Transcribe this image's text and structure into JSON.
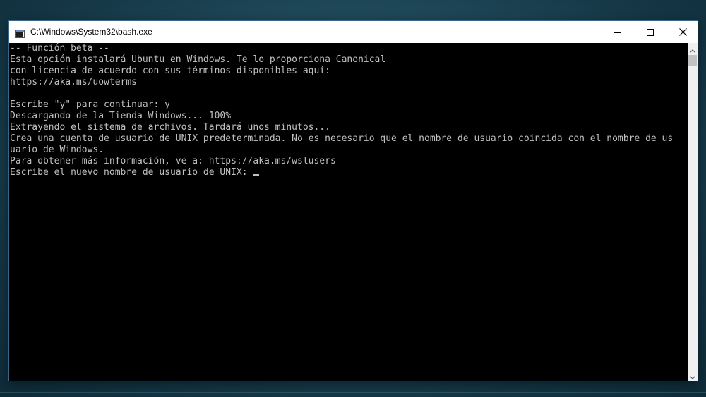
{
  "window": {
    "title": "C:\\Windows\\System32\\bash.exe",
    "icon": "console-window-icon",
    "controls": {
      "minimize_icon": "minimize-icon",
      "maximize_icon": "maximize-icon",
      "close_icon": "close-icon"
    }
  },
  "terminal": {
    "lines": [
      "-- Función beta --",
      "Esta opción instalará Ubuntu en Windows. Te lo proporciona Canonical",
      "con licencia de acuerdo con sus términos disponibles aquí:",
      "https://aka.ms/uowterms",
      "",
      "Escribe \"y\" para continuar: y",
      "Descargando de la Tienda Windows... 100%",
      "Extrayendo el sistema de archivos. Tardará unos minutos...",
      "Crea una cuenta de usuario de UNIX predeterminada. No es necesario que el nombre de usuario coincida con el nombre de us",
      "uario de Windows.",
      "Para obtener más información, ve a: https://aka.ms/wslusers",
      "Escribe el nuevo nombre de usuario de UNIX: "
    ]
  },
  "colors": {
    "terminal_background": "#000000",
    "terminal_text": "#c0c0c0",
    "window_border": "#1a6fb0"
  }
}
